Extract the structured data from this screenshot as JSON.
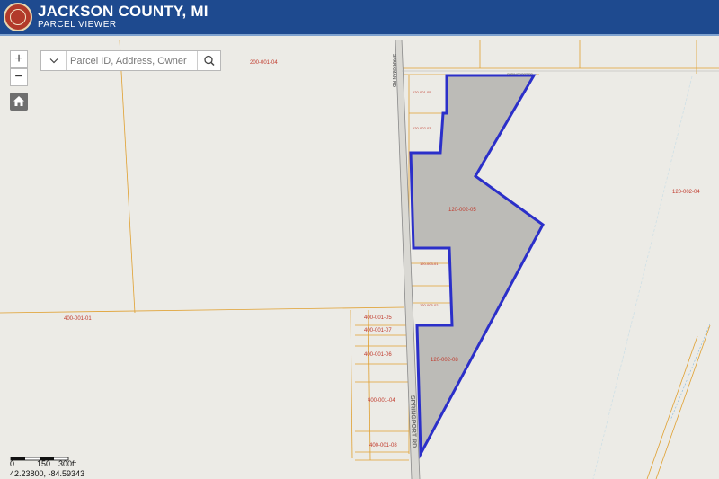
{
  "app": {
    "title": "JACKSON COUNTY, MI",
    "subtitle": "PARCEL VIEWER",
    "seal_icon": "county-seal-icon"
  },
  "colors": {
    "header_bg": "#1e4a8f",
    "parcel_line": "#e0a030",
    "selection_outline": "#2b2fc9",
    "selection_fill": "#b9b8b4",
    "parcel_label": "#c0392b",
    "map_bg": "#ecebe6"
  },
  "controls": {
    "zoom_in_label": "+",
    "zoom_out_label": "−",
    "home_icon": "home-icon"
  },
  "search": {
    "placeholder": "Parcel ID, Address, Owner Name",
    "value": "",
    "dropdown_icon": "chevron-down-icon",
    "search_icon": "search-icon"
  },
  "map": {
    "road_name": "SPRINGPORT RD",
    "road_name_vertical": "SPARKMAN RD",
    "selected_parcel": "120-002-05",
    "parcel_labels": [
      {
        "text": "200-001-04"
      },
      {
        "text": "400-001-01"
      },
      {
        "text": "400-001-05"
      },
      {
        "text": "400-001-07"
      },
      {
        "text": "400-001-06"
      },
      {
        "text": "400-001-04"
      },
      {
        "text": "400-001-08"
      },
      {
        "text": "120-002-05"
      },
      {
        "text": "120-002-08"
      },
      {
        "text": "120-002-04"
      },
      {
        "text": "120-001-05"
      },
      {
        "text": "120-002-03"
      },
      {
        "text": "120-003-01"
      },
      {
        "text": "120-006-02"
      }
    ]
  },
  "scale": {
    "ticks": [
      "0",
      "150",
      "300ft"
    ]
  },
  "coords": "42.23800, -84.59343"
}
